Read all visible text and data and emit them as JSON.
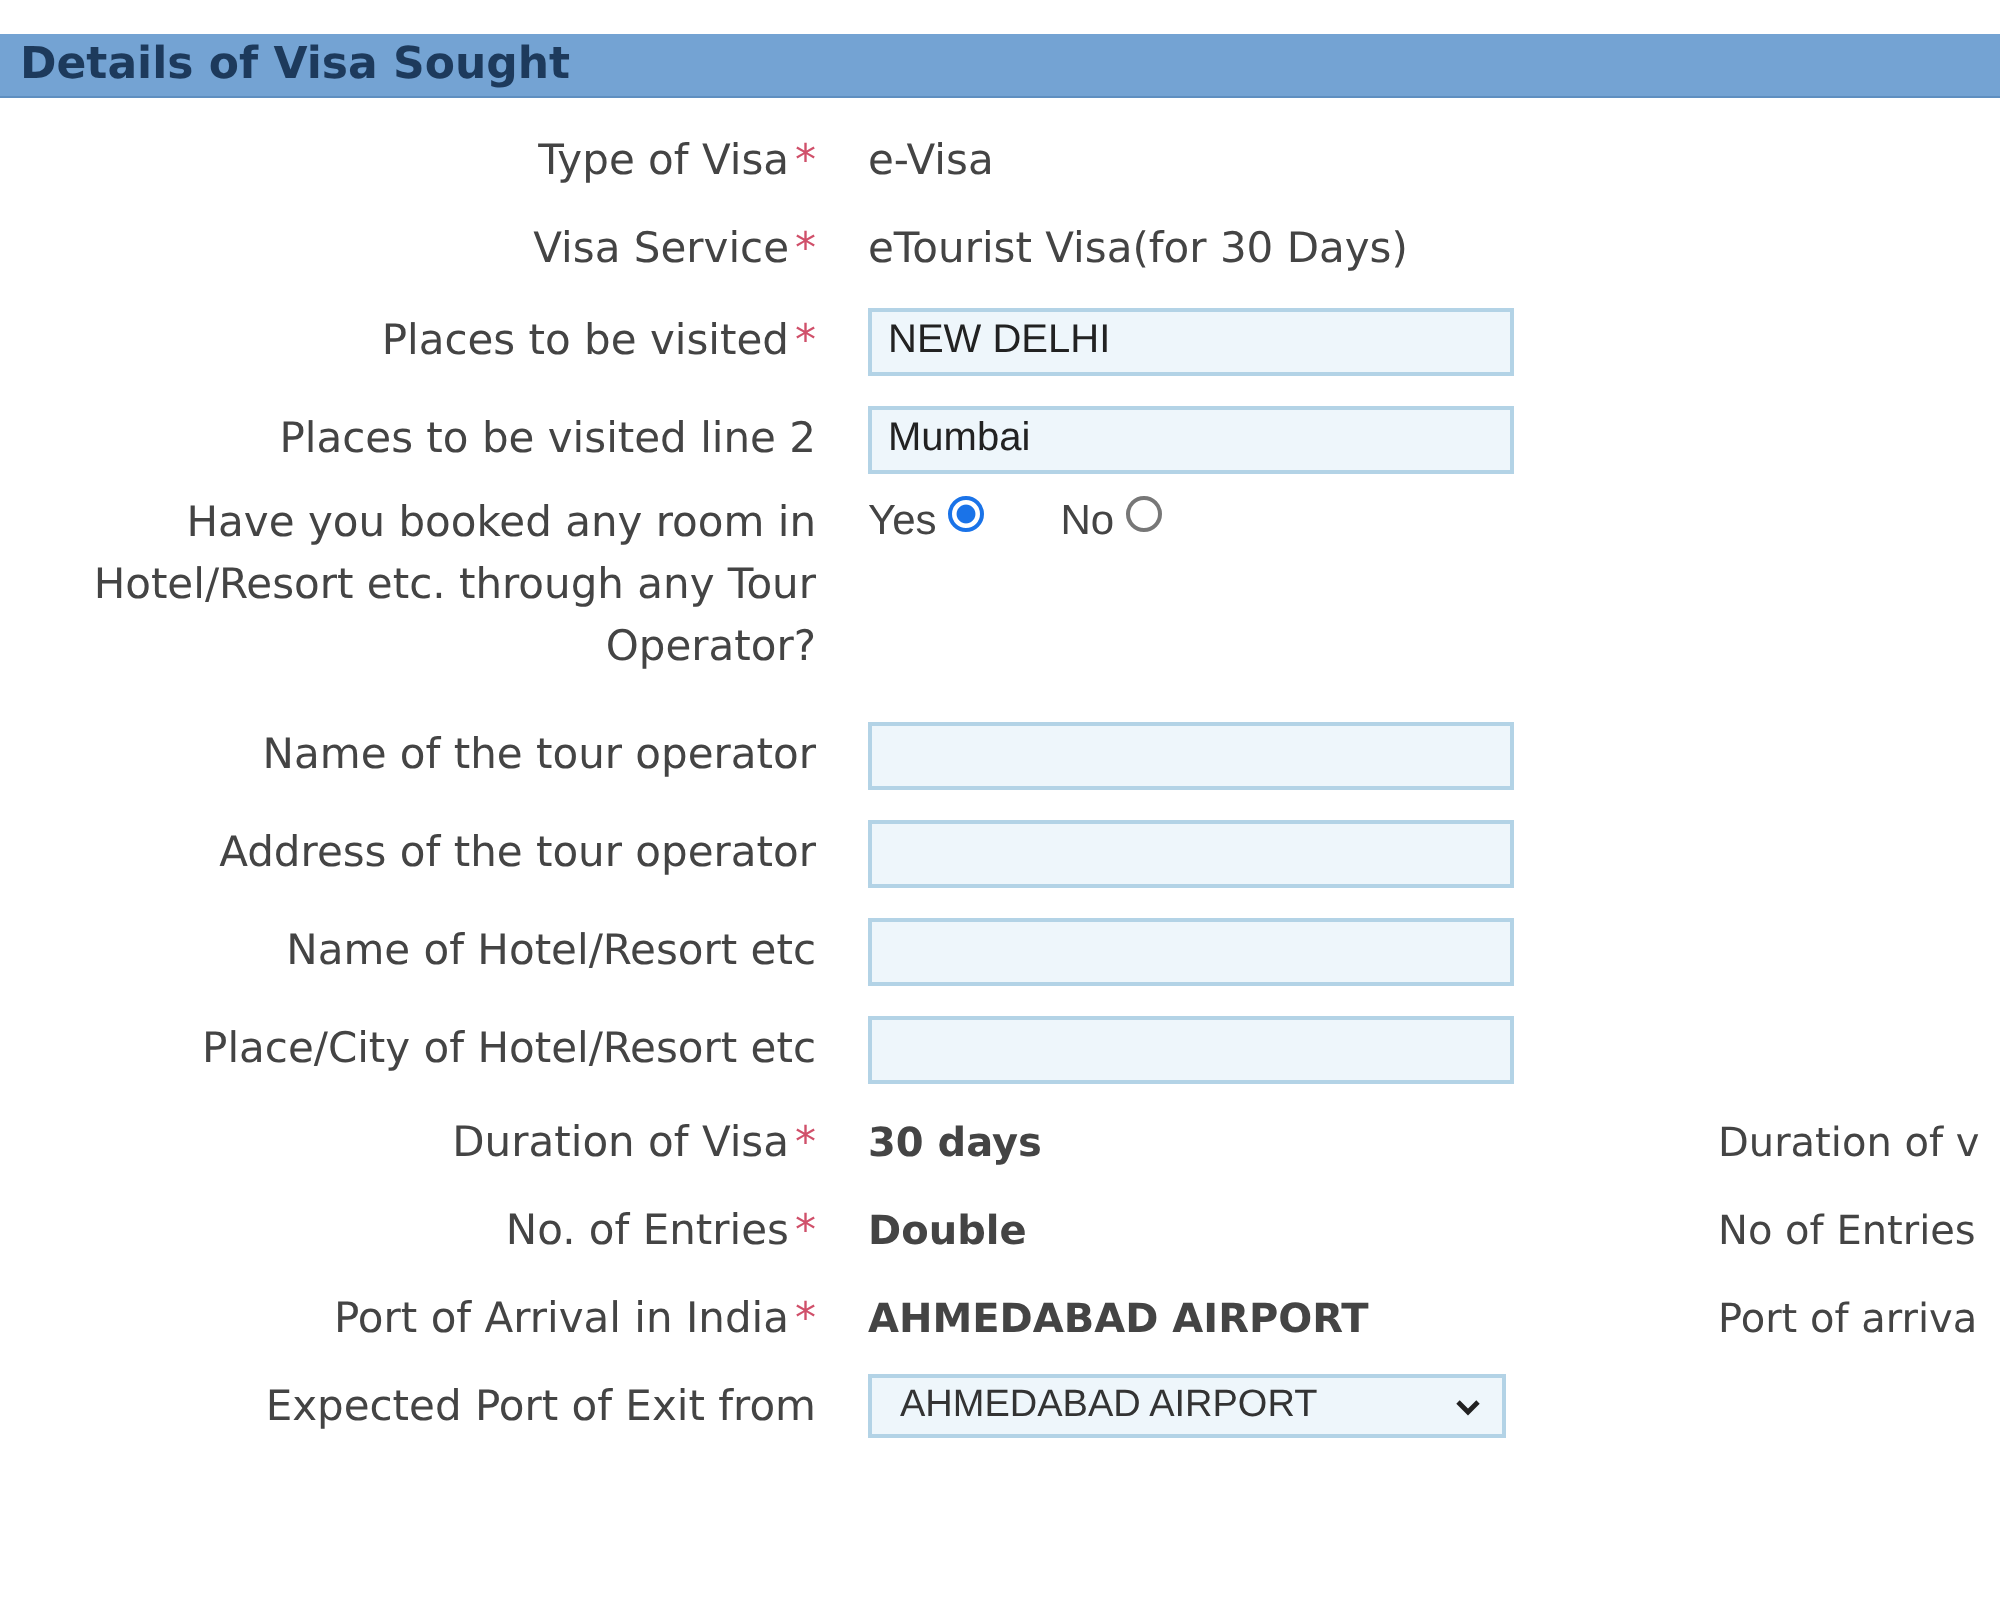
{
  "section": {
    "title": "Details of Visa Sought"
  },
  "fields": [
    {
      "kind": "text",
      "label": "Type of Visa",
      "required_mark": "*",
      "value": "e-Visa"
    },
    {
      "kind": "text",
      "label": "Visa Service",
      "required_mark": "*",
      "value": "eTourist Visa(for 30 Days)"
    },
    {
      "kind": "input",
      "label": "Places to be visited",
      "required_mark": "*",
      "value": "NEW DELHI"
    },
    {
      "kind": "input",
      "label": "Places to be visited line 2",
      "value": "Mumbai"
    },
    {
      "kind": "radio",
      "label": "Have you booked any room in Hotel/Resort etc. through any Tour Operator?",
      "options": [
        {
          "label": "Yes",
          "selected": true
        },
        {
          "label": "No",
          "selected": false
        }
      ]
    },
    {
      "kind": "input",
      "label": "Name of the tour operator"
    },
    {
      "kind": "input",
      "label": "Address of the tour operator"
    },
    {
      "kind": "input",
      "label": "Name of Hotel/Resort etc"
    },
    {
      "kind": "input",
      "label": "Place/City of Hotel/Resort etc"
    },
    {
      "kind": "bold",
      "label": "Duration of Visa",
      "required_mark": "*",
      "value": "30 days",
      "side_text": "Duration of v"
    },
    {
      "kind": "bold",
      "label": "No. of Entries",
      "required_mark": "*",
      "value": "Double",
      "side_text": "No of Entries"
    },
    {
      "kind": "bold",
      "label": "Port of Arrival in India",
      "required_mark": "*",
      "value": "AHMEDABAD AIRPORT",
      "side_text": "Port of arriva"
    },
    {
      "kind": "select",
      "label": "Expected Port of Exit from",
      "value": "AHMEDABAD AIRPORT"
    }
  ]
}
